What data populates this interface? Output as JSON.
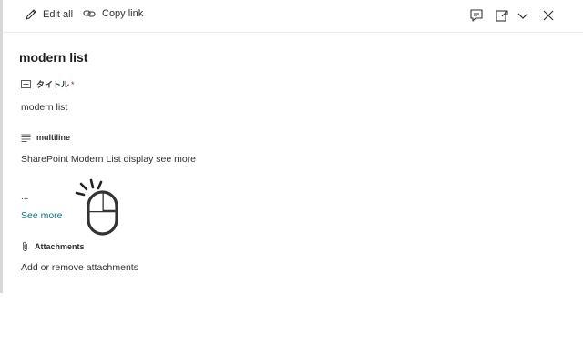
{
  "toolbar": {
    "edit_all_label": "Edit all",
    "copy_link_label": "Copy link",
    "icons": [
      "pencil-icon",
      "link-icon",
      "comment-icon",
      "open-panel-icon",
      "chevron-down-icon",
      "close-icon"
    ]
  },
  "item": {
    "title": "modern list"
  },
  "fields": {
    "title_field": {
      "label": "タイトル",
      "required_marker": "*",
      "value": "modern list"
    },
    "multiline_field": {
      "label": "multiline",
      "value": "SharePoint Modern List display see more",
      "ellipsis": "...",
      "see_more": "See more"
    },
    "attachments": {
      "label": "Attachments",
      "value": "Add or remove attachments"
    }
  },
  "colors": {
    "link": "#03787c",
    "text": "#323130",
    "required": "#a4262c"
  }
}
